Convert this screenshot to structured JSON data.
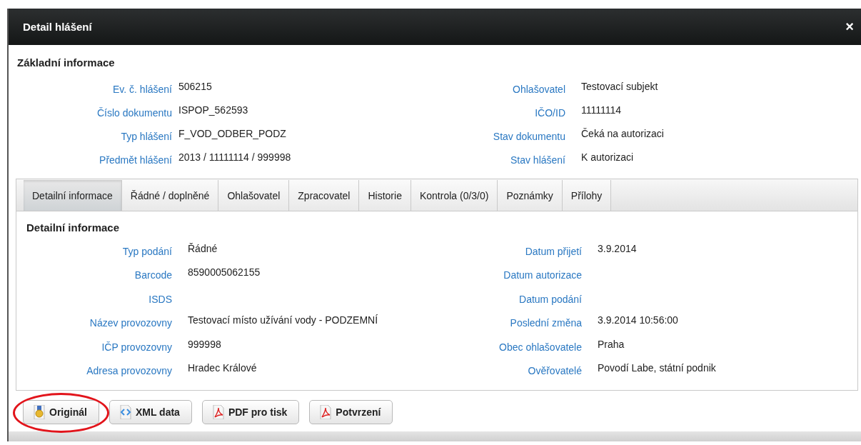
{
  "window": {
    "title": "Detail hlášení",
    "close": "×"
  },
  "basic_info": {
    "heading": "Základní informace",
    "left": [
      {
        "label": "Ev. č. hlášení",
        "value": "506215"
      },
      {
        "label": "Číslo dokumentu",
        "value": "ISPOP_562593"
      },
      {
        "label": "Typ hlášení",
        "value": "F_VOD_ODBER_PODZ"
      },
      {
        "label": "Předmět hlášení",
        "value": "2013 / 11111114 / 999998"
      }
    ],
    "right": [
      {
        "label": "Ohlašovatel",
        "value": "Testovací subjekt"
      },
      {
        "label": "IČO/ID",
        "value": "11111114"
      },
      {
        "label": "Stav dokumentu",
        "value": "Čeká na autorizaci"
      },
      {
        "label": "Stav hlášení",
        "value": "K autorizaci"
      }
    ]
  },
  "tabs": [
    {
      "label": "Detailní informace",
      "selected": true
    },
    {
      "label": "Řádné / doplněné",
      "selected": false
    },
    {
      "label": "Ohlašovatel",
      "selected": false
    },
    {
      "label": "Zpracovatel",
      "selected": false
    },
    {
      "label": "Historie",
      "selected": false
    },
    {
      "label": "Kontrola (0/3/0)",
      "selected": false
    },
    {
      "label": "Poznámky",
      "selected": false
    },
    {
      "label": "Přílohy",
      "selected": false
    }
  ],
  "detail": {
    "heading": "Detailní informace",
    "left": [
      {
        "label": "Typ podání",
        "value": "Řádné"
      },
      {
        "label": "Barcode",
        "value": "8590005062155"
      },
      {
        "label": "ISDS"
      },
      {
        "label": "Název provozovny",
        "value": "Testovací místo užívání vody - PODZEMNÍ"
      },
      {
        "label": "IČP provozovny",
        "value": "999998"
      },
      {
        "label": "Adresa provozovny",
        "value": "Hradec Králové"
      }
    ],
    "right": [
      {
        "label": "Datum přijetí",
        "value": "3.9.2014"
      },
      {
        "label": "Datum autorizace"
      },
      {
        "label": "Datum podání"
      },
      {
        "label": "Poslední změna",
        "value": "3.9.2014 10:56:00"
      },
      {
        "label": "Obec ohlašovatele",
        "value": "Praha"
      },
      {
        "label": "Ověřovatelé",
        "value": "Povodí Labe, státní podnik"
      }
    ]
  },
  "buttons": [
    {
      "label": "Originál",
      "kind": "original",
      "circled": true
    },
    {
      "label": "XML data",
      "kind": "xml",
      "circled": false
    },
    {
      "label": "PDF pro tisk",
      "kind": "pdf",
      "circled": false
    },
    {
      "label": "Potvrzení",
      "kind": "pdf",
      "circled": false
    }
  ]
}
